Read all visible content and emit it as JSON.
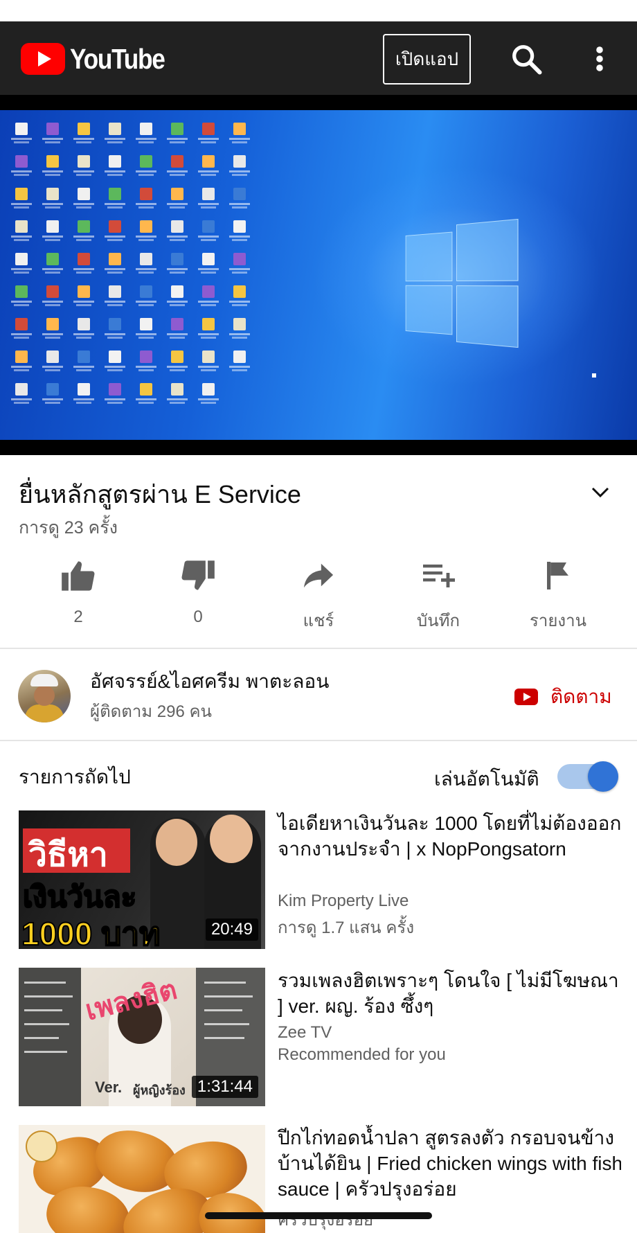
{
  "header": {
    "logo_text": "YouTube",
    "open_app_label": "เปิดแอป",
    "search_icon": "search-icon",
    "more_icon": "more-vert-icon"
  },
  "video": {
    "title": "ยื่นหลักสูตรผ่าน E Service",
    "views": "การดู 23 ครั้ง"
  },
  "actions": [
    {
      "name": "like",
      "icon": "thumbs-up-icon",
      "label": "2"
    },
    {
      "name": "dislike",
      "icon": "thumbs-down-icon",
      "label": "0"
    },
    {
      "name": "share",
      "icon": "share-icon",
      "label": "แชร์"
    },
    {
      "name": "save",
      "icon": "playlist-add-icon",
      "label": "บันทึก"
    },
    {
      "name": "report",
      "icon": "flag-icon",
      "label": "รายงาน"
    }
  ],
  "channel": {
    "name": "อัศจรรย์&ไอศครีม พาตะลอน",
    "subscribers": "ผู้ติดตาม 296 คน",
    "subscribe_label": "ติดตาม"
  },
  "up_next": {
    "label": "รายการถัดไป",
    "autoplay_label": "เล่นอัตโนมัติ",
    "autoplay_on": true
  },
  "videos": [
    {
      "title": "ไอเดียหาเงินวันละ 1000 โดยที่ไม่ต้องออกจากงานประจำ | x NopPongsatorn",
      "channel": "Kim Property Live",
      "meta": "การดู 1.7 แสน ครั้ง",
      "duration": "20:49",
      "thumb_text": [
        "วิธีหา",
        "เงินวันละ",
        "1000 บาท"
      ]
    },
    {
      "title": "รวมเพลงฮิตเพราะๆ โดนใจ [ ไม่มีโฆษณา ] ver. ผญ. ร้อง ซึ้งๆ",
      "channel": "Zee TV",
      "meta": "Recommended for you",
      "duration": "1:31:44",
      "thumb_text": [
        "เพลงฮิต",
        "Ver.",
        "ผู้หญิงร้อง"
      ]
    },
    {
      "title": "ปีกไก่ทอดน้ำปลา สูตรลงตัว กรอบจนข้างบ้านได้ยิน | Fried chicken wings with fish sauce | ครัวปรุงอร่อย",
      "channel": "ครัวปรุงอร่อย"
    }
  ],
  "colors": {
    "header_bg": "#212121",
    "accent_red": "#cc0000",
    "toggle_track": "#a9c7ec",
    "toggle_knob": "#3073d6"
  }
}
